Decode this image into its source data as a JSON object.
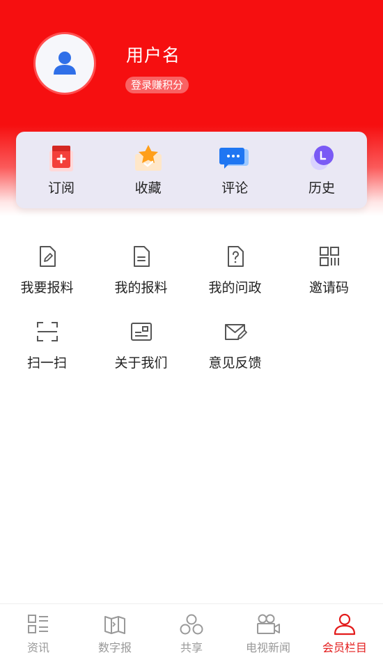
{
  "profile": {
    "username": "用户名",
    "login_hint": "登录赚积分"
  },
  "quick_actions": [
    {
      "label": "订阅",
      "icon": "subscribe-icon"
    },
    {
      "label": "收藏",
      "icon": "star-folder-icon"
    },
    {
      "label": "评论",
      "icon": "comment-bubble-icon"
    },
    {
      "label": "历史",
      "icon": "history-clock-icon"
    }
  ],
  "services": [
    {
      "label": "我要报料",
      "icon": "edit-document-icon"
    },
    {
      "label": "我的报料",
      "icon": "document-icon"
    },
    {
      "label": "我的问政",
      "icon": "question-document-icon"
    },
    {
      "label": "邀请码",
      "icon": "qr-code-icon"
    },
    {
      "label": "扫一扫",
      "icon": "scan-icon"
    },
    {
      "label": "关于我们",
      "icon": "about-card-icon"
    },
    {
      "label": "意见反馈",
      "icon": "feedback-mail-icon"
    }
  ],
  "tabbar": {
    "items": [
      {
        "label": "资讯",
        "icon": "list-icon"
      },
      {
        "label": "数字报",
        "icon": "newspaper-icon"
      },
      {
        "label": "共享",
        "icon": "share-circles-icon"
      },
      {
        "label": "电视新闻",
        "icon": "video-camera-icon"
      },
      {
        "label": "会员栏目",
        "icon": "user-icon"
      }
    ],
    "active_index": 4
  },
  "colors": {
    "brand_red": "#f60f10",
    "active_tab": "#e31b1b",
    "inactive_tab": "#999999"
  }
}
